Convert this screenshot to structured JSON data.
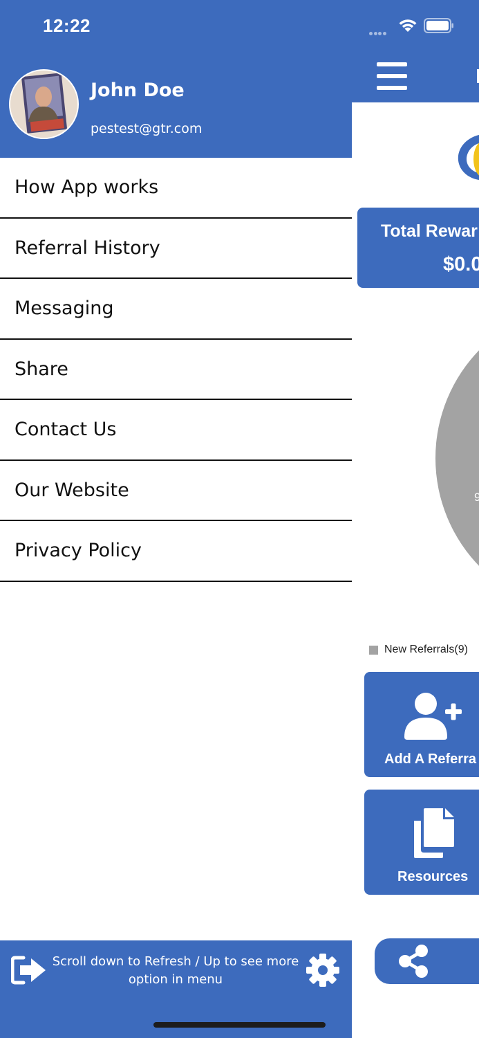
{
  "status_bar": {
    "time": "12:22"
  },
  "drawer": {
    "user": {
      "name": "John Doe",
      "email": "pestest@gtr.com"
    },
    "menu": [
      {
        "label": "How App works"
      },
      {
        "label": "Referral History"
      },
      {
        "label": "Messaging"
      },
      {
        "label": "Share"
      },
      {
        "label": "Contact Us"
      },
      {
        "label": "Our Website"
      },
      {
        "label": "Privacy Policy"
      }
    ],
    "footer_text": "Scroll down to Refresh / Up to see more option in menu"
  },
  "main": {
    "total_rewards_title": "Total Rewar",
    "total_rewards_value": "$0.0",
    "pie_label": "9",
    "legend_label": "New Referrals(9)",
    "add_referral_label": "Add A Referra",
    "resources_label": "Resources"
  },
  "colors": {
    "primary": "#3d6bbd",
    "pie": "#a3a3a3",
    "logo_yellow": "#f2c31b"
  }
}
